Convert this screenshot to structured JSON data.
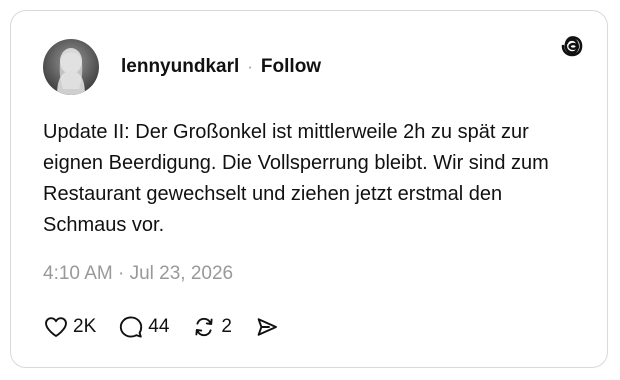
{
  "post": {
    "username": "lennyundkarl",
    "separator": "·",
    "follow_label": "Follow",
    "text": "Update II: Der Großonkel ist mittlerweile 2h zu spät zur eignen Beerdigung. Die Vollsperrung bleibt. Wir sind zum Restaurant gewechselt und ziehen jetzt erstmal den Schmaus vor.",
    "timestamp": "4:10 AM · Jul 23, 2026"
  },
  "actions": {
    "like_count": "2K",
    "reply_count": "44",
    "repost_count": "2"
  },
  "icons": {
    "logo": "threads-logo-icon",
    "like": "heart-icon",
    "reply": "comment-icon",
    "repost": "repost-icon",
    "share": "send-icon"
  },
  "colors": {
    "text": "#111111",
    "muted": "#999999",
    "border": "#d9d9d9"
  }
}
